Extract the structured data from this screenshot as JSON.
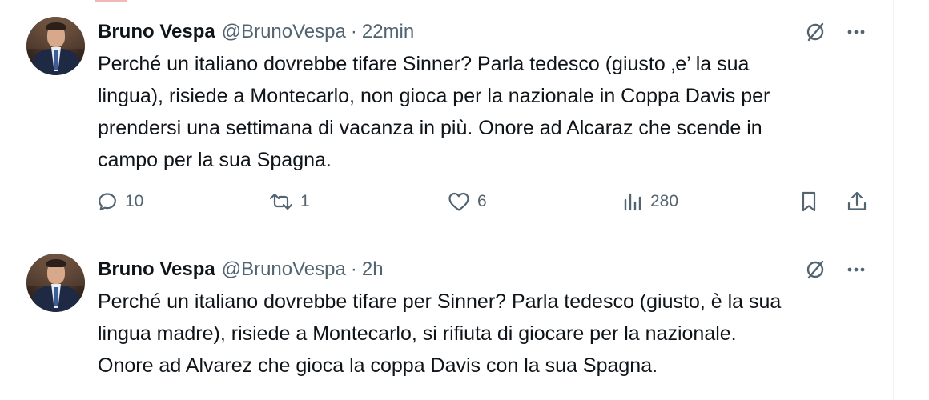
{
  "colors": {
    "text_primary": "#0f1419",
    "text_secondary": "#536471",
    "divider": "#eff3f4"
  },
  "tweets": [
    {
      "author": {
        "display_name": "Bruno Vespa",
        "handle": "@BrunoVespa"
      },
      "separator": "·",
      "time": "22min",
      "text": "Perché un italiano dovrebbe tifare Sinner? Parla tedesco (giusto ‚e’ la sua\nlingua), risiede a Montecarlo, non gioca per la nazionale in Coppa Davis per\nprendersi una settimana di vacanza in più. Onore ad Alcaraz che scende in\ncampo per la sua Spagna.",
      "actions": {
        "replies": "10",
        "reposts": "1",
        "likes": "6",
        "views": "280"
      },
      "icons": {
        "grok": "grok-icon",
        "more": "more-icon",
        "reply": "reply-icon",
        "repost": "repost-icon",
        "like": "heart-icon",
        "views": "analytics-icon",
        "bookmark": "bookmark-icon",
        "share": "share-icon"
      }
    },
    {
      "author": {
        "display_name": "Bruno Vespa",
        "handle": "@BrunoVespa"
      },
      "separator": "·",
      "time": "2h",
      "text": "Perché un italiano dovrebbe tifare per Sinner? Parla tedesco (giusto, è la sua\nlingua madre), risiede a Montecarlo, si rifiuta di giocare per la nazionale.\nOnore ad Alvarez che gioca la coppa Davis con la sua Spagna.",
      "icons": {
        "grok": "grok-icon",
        "more": "more-icon"
      }
    }
  ]
}
